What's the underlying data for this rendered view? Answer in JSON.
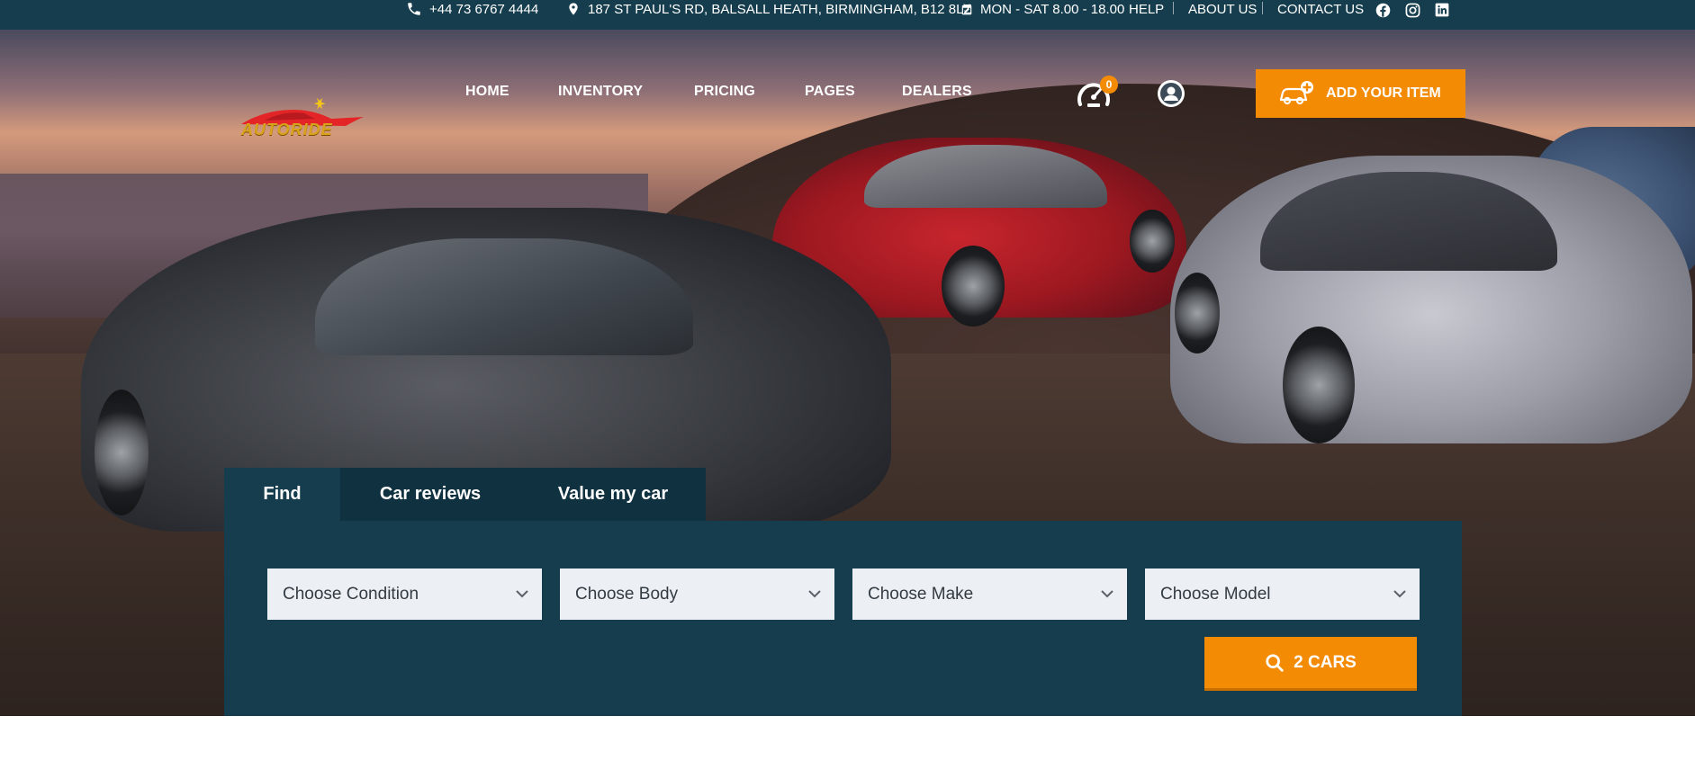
{
  "topbar": {
    "phone": "+44 73 6767 4444",
    "address": "187 ST PAUL'S RD, BALSALL HEATH, BIRMINGHAM, B12 8LZ",
    "hours": "MON - SAT 8.00 - 18.00",
    "links": [
      "HELP",
      "ABOUT US",
      "CONTACT US"
    ],
    "social_icons": [
      "facebook-icon",
      "instagram-icon",
      "linkedin-icon"
    ]
  },
  "header": {
    "logo_text": "AUTORIDE",
    "nav": [
      "HOME",
      "INVENTORY",
      "PRICING",
      "PAGES",
      "DEALERS"
    ],
    "compare_count": "0",
    "add_item_label": "ADD YOUR ITEM"
  },
  "search": {
    "tabs": [
      {
        "label": "Find",
        "active": true
      },
      {
        "label": "Car reviews",
        "active": false
      },
      {
        "label": "Value my car",
        "active": false
      }
    ],
    "selects": [
      {
        "placeholder": "Choose Condition"
      },
      {
        "placeholder": "Choose Body"
      },
      {
        "placeholder": "Choose Make"
      },
      {
        "placeholder": "Choose Model"
      }
    ],
    "submit_label": "2 CARS"
  },
  "colors": {
    "accent": "#f48b05",
    "dark_teal": "#153d4d",
    "select_bg": "#eceff4"
  }
}
